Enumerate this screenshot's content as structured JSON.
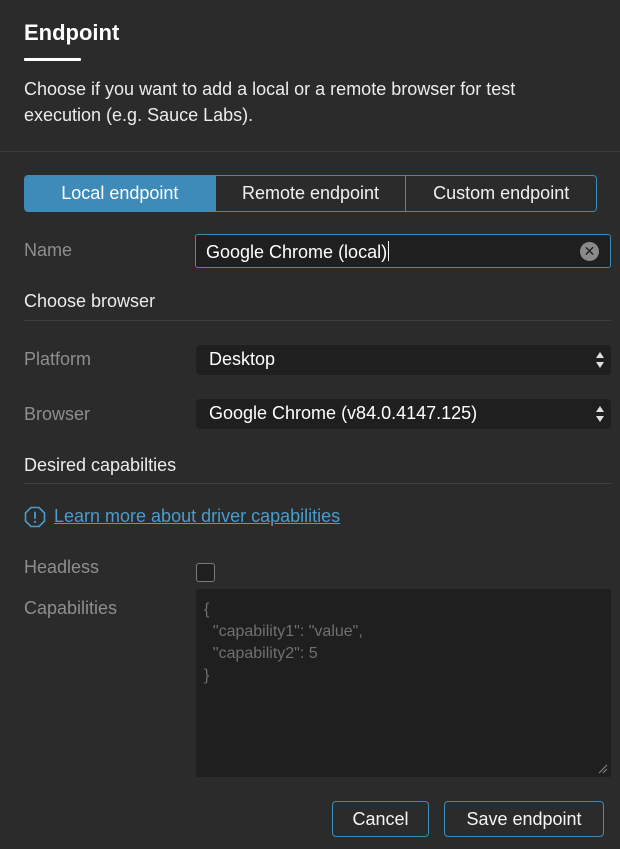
{
  "dialog": {
    "title": "Endpoint",
    "description": "Choose if you want to add a local or a remote browser for test execution (e.g. Sauce Labs)."
  },
  "tabs": [
    {
      "label": "Local endpoint",
      "active": true
    },
    {
      "label": "Remote endpoint",
      "active": false
    },
    {
      "label": "Custom endpoint",
      "active": false
    }
  ],
  "form": {
    "name_label": "Name",
    "name_value": "Google Chrome (local)",
    "choose_browser_heading": "Choose browser",
    "platform_label": "Platform",
    "platform_value": "Desktop",
    "browser_label": "Browser",
    "browser_value": "Google Chrome (v84.0.4147.125)",
    "capabilities_heading": "Desired capabilties",
    "info_link": "Learn more about driver capabilities",
    "headless_label": "Headless",
    "headless_checked": false,
    "capabilities_label": "Capabilities",
    "capabilities_placeholder": "{\n  \"capability1\": \"value\",\n  \"capability2\": 5\n}"
  },
  "footer": {
    "cancel_label": "Cancel",
    "save_label": "Save endpoint"
  },
  "colors": {
    "accent": "#3e8ab8",
    "link": "#4a9ccb",
    "background": "#2b2b2c",
    "field_background": "#1f1f20"
  }
}
